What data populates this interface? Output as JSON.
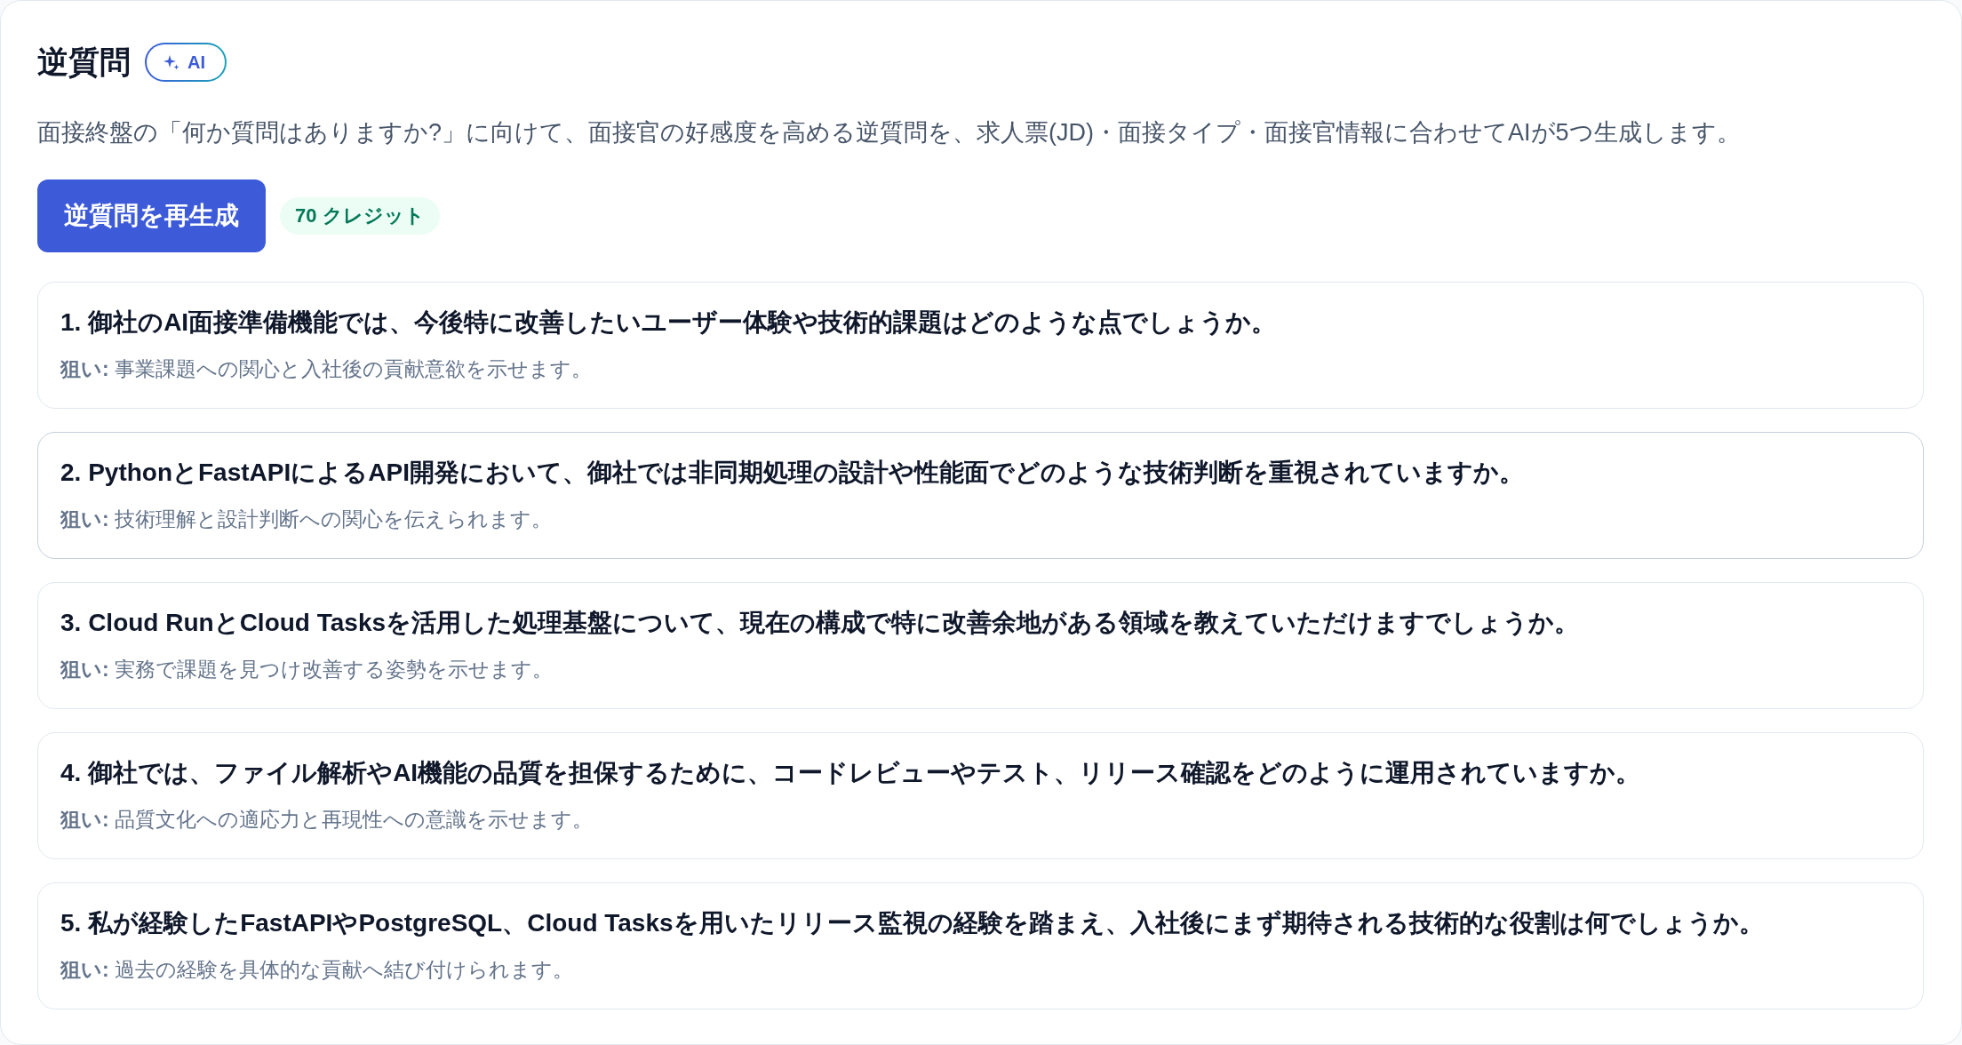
{
  "header": {
    "title": "逆質問",
    "badge": "AI"
  },
  "description": "面接終盤の「何か質問はありますか?」に向けて、面接官の好感度を高める逆質問を、求人票(JD)・面接タイプ・面接官情報に合わせてAIが5つ生成します。",
  "actions": {
    "button": "逆質問を再生成",
    "credits": "70 クレジット"
  },
  "questions": [
    {
      "question": "1. 御社のAI面接準備機能では、今後特に改善したいユーザー体験や技術的課題はどのような点でしょうか。",
      "aim": "**狙い:** 事業課題への関心と入社後の貢献意欲を示せます。",
      "highlighted": false
    },
    {
      "question": "2. PythonとFastAPIによるAPI開発において、御社では非同期処理の設計や性能面でどのような技術判断を重視されていますか。",
      "aim": "**狙い:** 技術理解と設計判断への関心を伝えられます。",
      "highlighted": true
    },
    {
      "question": "3. Cloud RunとCloud Tasksを活用した処理基盤について、現在の構成で特に改善余地がある領域を教えていただけますでしょうか。",
      "aim": "**狙い:** 実務で課題を見つけ改善する姿勢を示せます。",
      "highlighted": false
    },
    {
      "question": "4. 御社では、ファイル解析やAI機能の品質を担保するために、コードレビューやテスト、リリース確認をどのように運用されていますか。",
      "aim": "**狙い:** 品質文化への適応力と再現性への意識を示せます。",
      "highlighted": false
    },
    {
      "question": "5. 私が経験したFastAPIやPostgreSQL、Cloud Tasksを用いたリリース監視の経験を踏まえ、入社後にまず期待される技術的な役割は何でしょうか。",
      "aim": "**狙い:** 過去の経験を具体的な貢献へ結び付けられます。",
      "highlighted": false
    }
  ]
}
